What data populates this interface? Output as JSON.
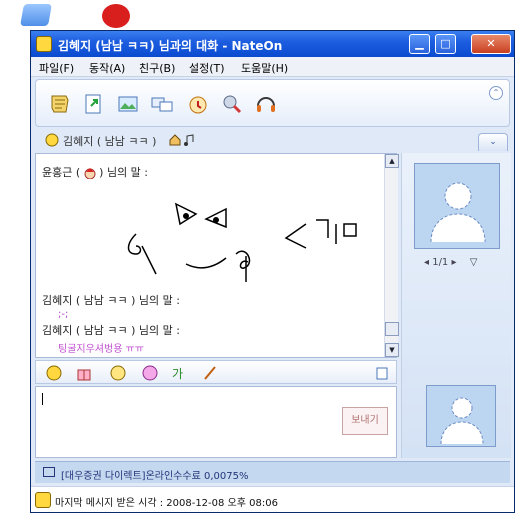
{
  "window": {
    "title": "김혜지 (남남 ㅋㅋ) 님과의 대화 - NateOn",
    "minimize": "▁",
    "maximize": "□",
    "close": "✕"
  },
  "menu": {
    "items": [
      "파일(F)",
      "동작(A)",
      "친구(B)",
      "설정(T)",
      "도움말(H)"
    ]
  },
  "toolbar": {
    "icons": [
      "note-icon",
      "file-send-icon",
      "photo-icon",
      "screen-share-icon",
      "alarm-icon",
      "voice-icon",
      "headset-icon"
    ],
    "more": "⌃"
  },
  "contact": {
    "name": "김혜지 ( 남남 ㅋㅋ )",
    "tab_label": "⌄"
  },
  "chat": {
    "messages": [
      {
        "speaker": "윤홍근 ( ",
        "speaker_suffix": " ) 님의 말 :"
      },
      {
        "speaker": "김혜지 ( 남남 ㅋㅋ ) 님의 말 :",
        "body": ";-;"
      },
      {
        "speaker": "김혜지 ( 남남 ㅋㅋ ) 님의 말 :",
        "body": "팅굴지우셔벙용 ㅠㅠ"
      }
    ]
  },
  "send_button": "보내기",
  "avatar": {
    "page": "1/1"
  },
  "ad": {
    "text": "[대우증권 다이렉트]온라인수수료 0,0075%"
  },
  "status": {
    "last_message": "마지막 메시지 받은 시각 : 2008-12-08 오후 08:06"
  }
}
